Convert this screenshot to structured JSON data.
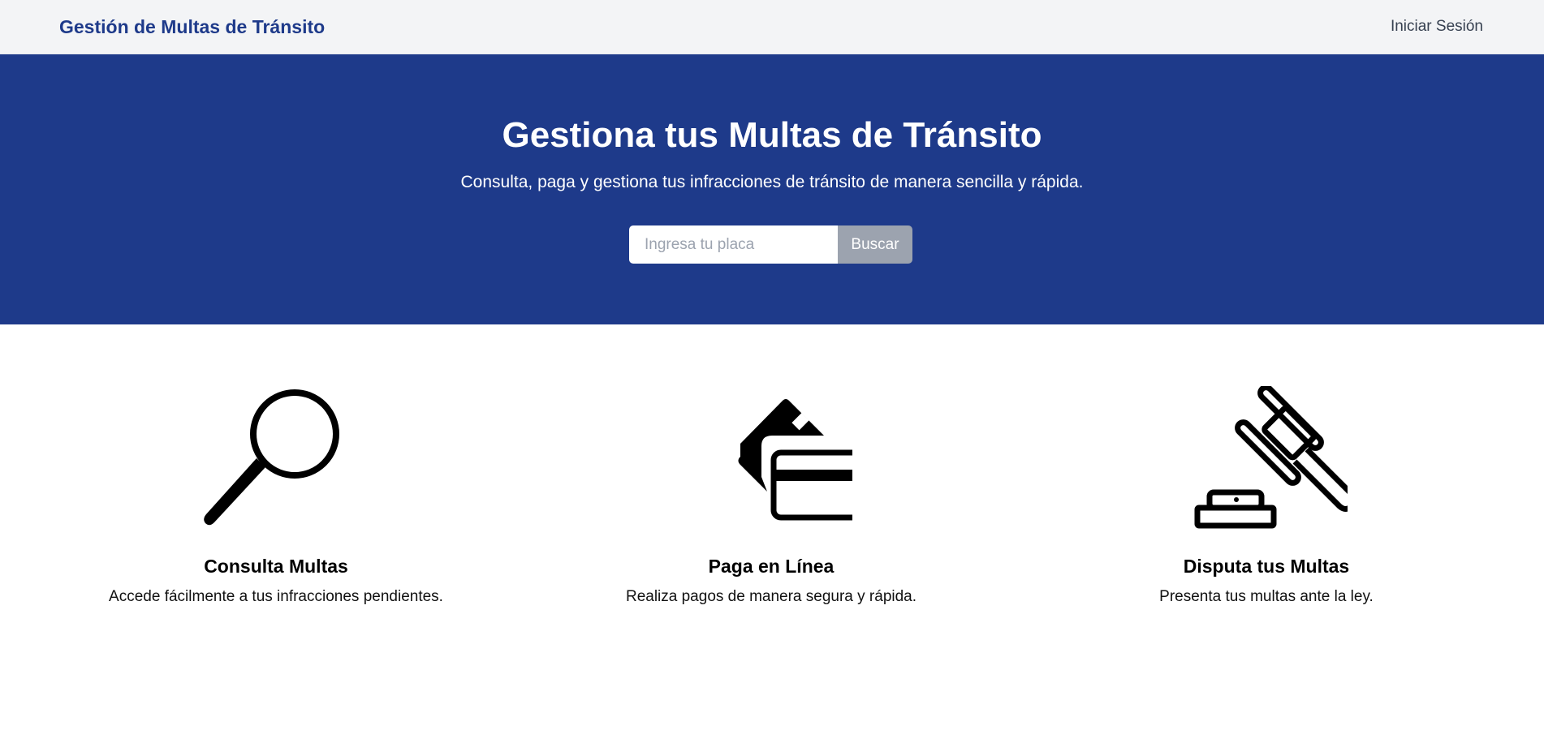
{
  "header": {
    "brand": "Gestión de Multas de Tránsito",
    "login_label": "Iniciar Sesión"
  },
  "hero": {
    "title": "Gestiona tus Multas de Tránsito",
    "subtitle": "Consulta, paga y gestiona tus infracciones de tránsito de manera sencilla y rápida.",
    "search_value": "",
    "search_placeholder": "Ingresa tu placa",
    "search_button": "Buscar"
  },
  "features": [
    {
      "icon": "magnifying-glass-icon",
      "title": "Consulta Multas",
      "description": "Accede fácilmente a tus infracciones pendientes."
    },
    {
      "icon": "credit-card-icon",
      "title": "Paga en Línea",
      "description": "Realiza pagos de manera segura y rápida."
    },
    {
      "icon": "gavel-icon",
      "title": "Disputa tus Multas",
      "description": "Presenta tus multas ante la ley."
    }
  ],
  "colors": {
    "primary": "#1e3a8a",
    "header_bg": "#f3f4f6",
    "button_bg": "#9ca3af"
  }
}
